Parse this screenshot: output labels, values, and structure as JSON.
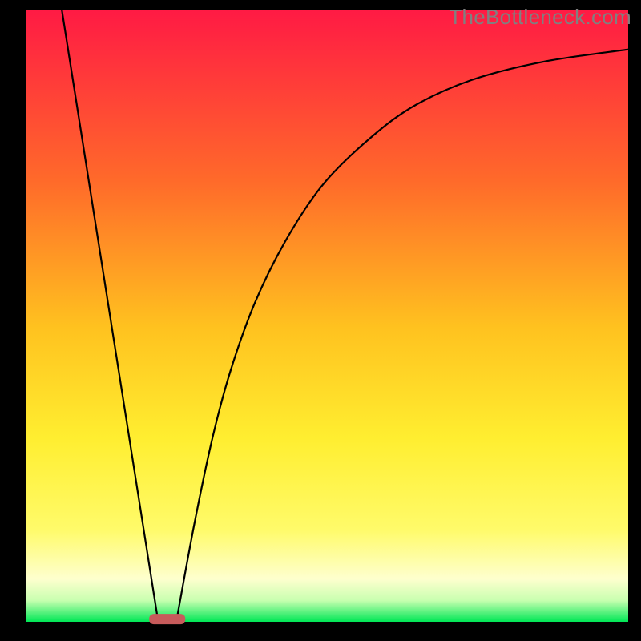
{
  "watermark": "TheBottleneck.com",
  "colors": {
    "frame": "#000000",
    "watermark": "#808080",
    "curve_stroke": "#000000",
    "marker_fill": "#c75b5b",
    "gradient_top": "#ff1a44",
    "gradient_mid1": "#ff7a1f",
    "gradient_mid2": "#ffd21f",
    "gradient_mid3": "#fff23a",
    "gradient_pale": "#fdfec0",
    "gradient_green": "#00e756"
  },
  "chart_data": {
    "type": "line",
    "title": "",
    "xlabel": "",
    "ylabel": "",
    "xlim": [
      0,
      100
    ],
    "ylim": [
      0,
      100
    ],
    "series": [
      {
        "name": "left-line",
        "x": [
          6,
          22
        ],
        "values": [
          100,
          0
        ]
      },
      {
        "name": "right-curve",
        "x": [
          25,
          28,
          31,
          34,
          38,
          43,
          49,
          56,
          64,
          74,
          86,
          100
        ],
        "values": [
          0,
          16,
          30,
          41,
          52,
          62,
          71,
          78,
          84,
          88.5,
          91.5,
          93.5
        ]
      }
    ],
    "marker": {
      "x_center": 23.5,
      "x_halfwidth": 3.0,
      "y": 0.5
    },
    "legend": null,
    "grid": false
  }
}
